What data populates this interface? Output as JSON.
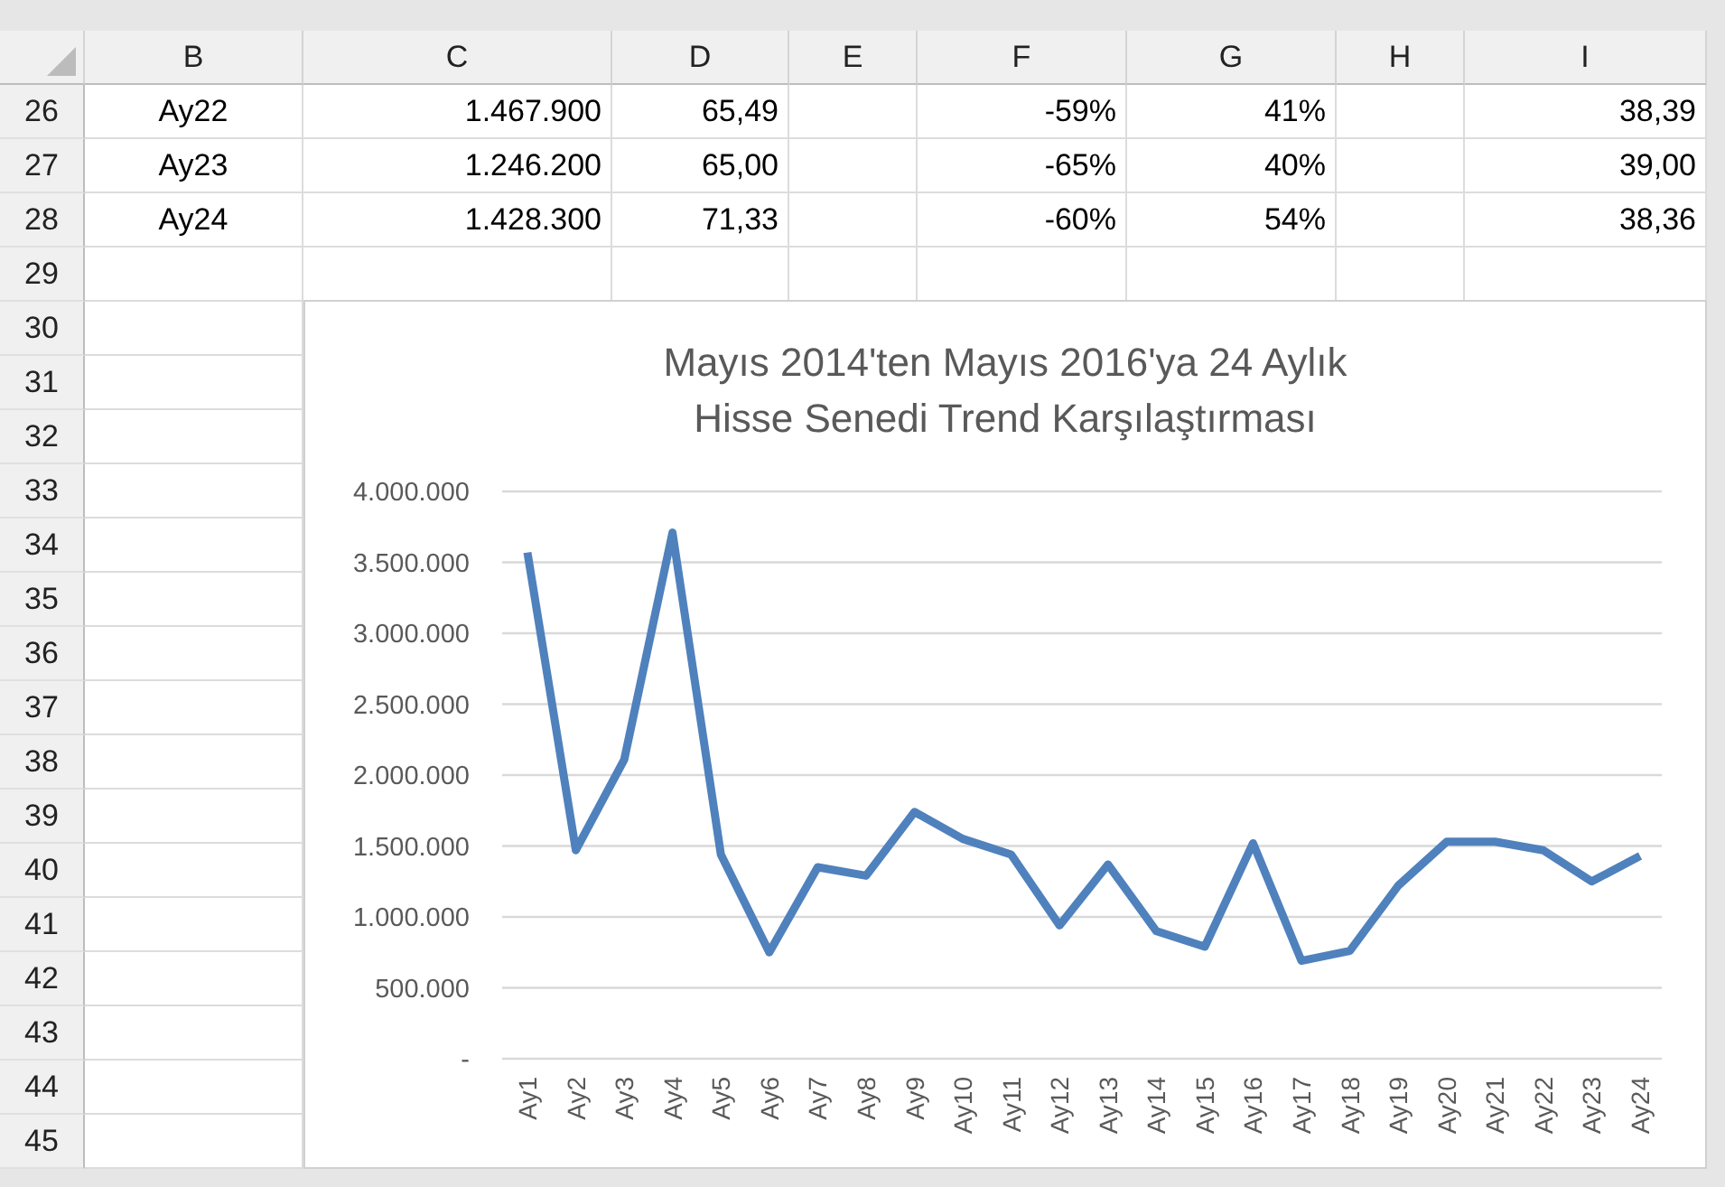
{
  "columns": [
    "B",
    "C",
    "D",
    "E",
    "F",
    "G",
    "H",
    "I"
  ],
  "rows": [
    {
      "number": "26",
      "cells": [
        "Ay22",
        "1.467.900",
        "65,49",
        null,
        "-59%",
        "41%",
        null,
        "38,39"
      ]
    },
    {
      "number": "27",
      "cells": [
        "Ay23",
        "1.246.200",
        "65,00",
        null,
        "-65%",
        "40%",
        null,
        "39,00"
      ]
    },
    {
      "number": "28",
      "cells": [
        "Ay24",
        "1.428.300",
        "71,33",
        null,
        "-60%",
        "54%",
        null,
        "38,36"
      ]
    },
    {
      "number": "29"
    },
    {
      "number": "30"
    },
    {
      "number": "31"
    },
    {
      "number": "32"
    },
    {
      "number": "33"
    },
    {
      "number": "34"
    },
    {
      "number": "35"
    },
    {
      "number": "36"
    },
    {
      "number": "37"
    },
    {
      "number": "38"
    },
    {
      "number": "39"
    },
    {
      "number": "40"
    },
    {
      "number": "41"
    },
    {
      "number": "42"
    },
    {
      "number": "43"
    },
    {
      "number": "44"
    },
    {
      "number": "45"
    }
  ],
  "chart": {
    "chart_data": {
      "type": "line",
      "title": "Mayıs 2014'ten Mayıs 2016'ya 24 Aylık Hisse Senedi Trend Karşılaştırması",
      "categories": [
        "Ay1",
        "Ay2",
        "Ay3",
        "Ay4",
        "Ay5",
        "Ay6",
        "Ay7",
        "Ay8",
        "Ay9",
        "Ay10",
        "Ay11",
        "Ay12",
        "Ay13",
        "Ay14",
        "Ay15",
        "Ay16",
        "Ay17",
        "Ay18",
        "Ay19",
        "Ay20",
        "Ay21",
        "Ay22",
        "Ay23",
        "Ay24"
      ],
      "series": [
        {
          "color": "#4f81bd",
          "values": [
            3570000,
            1470000,
            2110000,
            3710000,
            1440000,
            750000,
            1350000,
            1290000,
            1740000,
            1550000,
            1440000,
            940000,
            1370000,
            900000,
            790000,
            1520000,
            690000,
            760000,
            1220000,
            1530000,
            1530000,
            1470000,
            1250000,
            1430000
          ]
        }
      ],
      "grid": true,
      "ylim": [
        0,
        4000000
      ],
      "yticks": [
        {
          "value": 0,
          "label": "-"
        },
        {
          "value": 500000,
          "label": "500.000"
        },
        {
          "value": 1000000,
          "label": "1.000.000"
        },
        {
          "value": 1500000,
          "label": "1.500.000"
        },
        {
          "value": 2000000,
          "label": "2.000.000"
        },
        {
          "value": 2500000,
          "label": "2.500.000"
        },
        {
          "value": 3000000,
          "label": "3.000.000"
        },
        {
          "value": 3500000,
          "label": "3.500.000"
        },
        {
          "value": 4000000,
          "label": "4.000.000"
        }
      ]
    }
  }
}
